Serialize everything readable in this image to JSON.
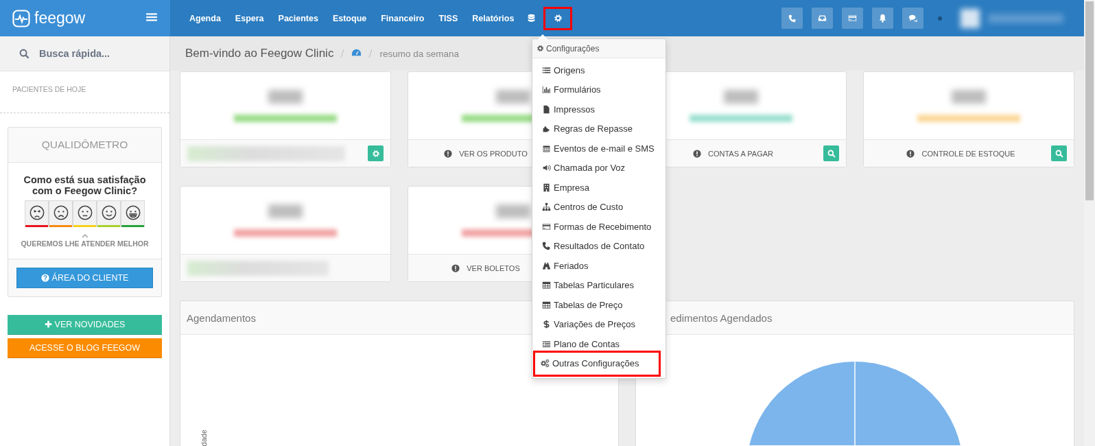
{
  "brand": {
    "name": "feegow"
  },
  "nav": [
    {
      "label": "Agenda"
    },
    {
      "label": "Espera"
    },
    {
      "label": "Pacientes"
    },
    {
      "label": "Estoque"
    },
    {
      "label": "Financeiro"
    },
    {
      "label": "TISS"
    },
    {
      "label": "Relatórios"
    }
  ],
  "settings_button": {
    "highlighted": true
  },
  "sidebar": {
    "search": {
      "placeholder": "Busca rápida..."
    },
    "section_title": "PACIENTES DE HOJE",
    "qualidometro": {
      "title": "QUALIDÔMETRO",
      "question": "Como está sua satisfação com o Feegow Clinic?",
      "faces": [
        {
          "color": "#e8141c"
        },
        {
          "color": "#f5890f"
        },
        {
          "color": "#f7d11a"
        },
        {
          "color": "#a8d12c"
        },
        {
          "color": "#25a33a"
        }
      ],
      "caption": "QUEREMOS LHE ATENDER MELHOR",
      "button": "ÁREA DO CLIENTE"
    },
    "buttons": [
      {
        "label": "VER NOVIDADES",
        "kind": "news"
      },
      {
        "label": "ACESSE O BLOG FEEGOW",
        "kind": "blog"
      }
    ]
  },
  "breadcrumb": {
    "title": "Bem-vindo ao Feegow Clinic",
    "current": "resumo da semana"
  },
  "cards": [
    {
      "color": "#9bdc8a",
      "footer": {
        "kind": "legend",
        "button": {
          "kind": "settings"
        }
      }
    },
    {
      "color": "#9bdc8a",
      "footer": {
        "kind": "label",
        "label": "VER OS PRODUTO"
      }
    },
    {
      "color": "#9be0d0",
      "footer": {
        "kind": "label",
        "label": "CONTAS A PAGAR",
        "button": {
          "kind": "search"
        }
      }
    },
    {
      "color": "#fbd89a",
      "footer": {
        "kind": "label",
        "label": "CONTROLE DE ESTOQUE",
        "button": {
          "kind": "search"
        }
      }
    },
    {
      "color": "#f2a3a3",
      "footer": {
        "kind": "legend"
      }
    },
    {
      "color": "#f2a3a3",
      "footer": {
        "kind": "label",
        "label": "VER BOLETOS"
      }
    }
  ],
  "panels": [
    {
      "title": "Agendamentos",
      "kind": "axis",
      "y_axis_label": "dade"
    },
    {
      "title": "edimentos Agendados",
      "kind": "pie"
    }
  ],
  "settings_menu": {
    "title": "Configurações",
    "items": [
      {
        "label": "Origens",
        "highlighted": false
      },
      {
        "label": "Formulários",
        "highlighted": false
      },
      {
        "label": "Impressos",
        "highlighted": false
      },
      {
        "label": "Regras de Repasse",
        "highlighted": false
      },
      {
        "label": "Eventos de e-mail e SMS",
        "highlighted": false
      },
      {
        "label": "Chamada por Voz",
        "highlighted": false
      },
      {
        "label": "Empresa",
        "highlighted": false
      },
      {
        "label": "Centros de Custo",
        "highlighted": false
      },
      {
        "label": "Formas de Recebimento",
        "highlighted": false
      },
      {
        "label": "Resultados de Contato",
        "highlighted": false
      },
      {
        "label": "Feriados",
        "highlighted": false
      },
      {
        "label": "Tabelas Particulares",
        "highlighted": false
      },
      {
        "label": "Tabelas de Preço",
        "highlighted": false
      },
      {
        "label": "Variações de Preços",
        "highlighted": false
      },
      {
        "label": "Plano de Contas",
        "highlighted": false
      },
      {
        "label": "Outras Configurações",
        "highlighted": true
      }
    ]
  }
}
